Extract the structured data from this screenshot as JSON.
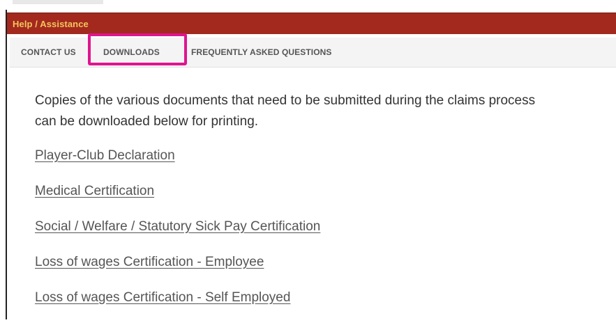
{
  "header": {
    "title": "Help / Assistance",
    "bar_color": "#a3291f",
    "title_color": "#f3c65a"
  },
  "tabs": [
    {
      "label": "CONTACT US"
    },
    {
      "label": "DOWNLOADS",
      "active": true,
      "highlight_color": "#e0148f"
    },
    {
      "label": "FREQUENTLY ASKED QUESTIONS"
    }
  ],
  "content": {
    "intro_line1": "Copies of the various documents that need to be submitted during the claims process",
    "intro_line2": "can be downloaded below for printing.",
    "links": [
      {
        "label": "Player-Club Declaration"
      },
      {
        "label": "Medical Certification"
      },
      {
        "label": "Social / Welfare / Statutory Sick Pay Certification"
      },
      {
        "label": "Loss of wages Certification - Employee"
      },
      {
        "label": "Loss of wages Certification - Self Employed"
      }
    ]
  }
}
